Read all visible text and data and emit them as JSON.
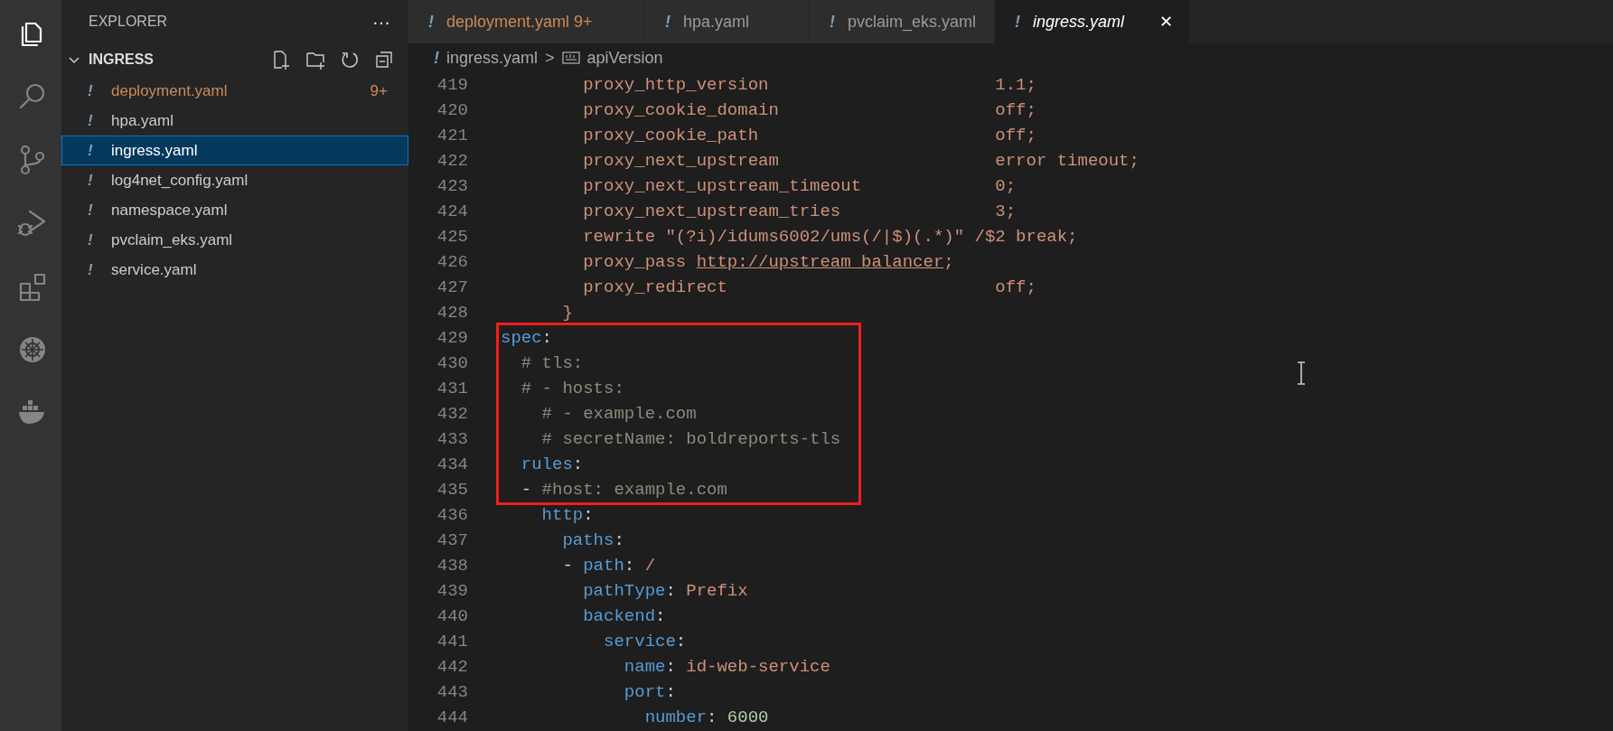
{
  "activity_bar": {
    "items": [
      {
        "kind": "files",
        "selected": true
      },
      {
        "kind": "search",
        "selected": false
      },
      {
        "kind": "source-control",
        "selected": false
      },
      {
        "kind": "debug",
        "selected": false
      },
      {
        "kind": "extensions",
        "selected": false
      },
      {
        "kind": "kubernetes",
        "selected": false
      },
      {
        "kind": "docker",
        "selected": false
      }
    ]
  },
  "sidebar": {
    "title": "EXPLORER",
    "more": "···",
    "section": {
      "title": "INGRESS",
      "expanded": true,
      "files": [
        {
          "icon": "!",
          "name": "deployment.yaml",
          "badge": "9+",
          "warning": true,
          "selected": false
        },
        {
          "icon": "!",
          "name": "hpa.yaml",
          "warning": false,
          "selected": false
        },
        {
          "icon": "!",
          "name": "ingress.yaml",
          "warning": false,
          "selected": true
        },
        {
          "icon": "!",
          "name": "log4net_config.yaml",
          "warning": false,
          "selected": false
        },
        {
          "icon": "!",
          "name": "namespace.yaml",
          "warning": false,
          "selected": false
        },
        {
          "icon": "!",
          "name": "pvclaim_eks.yaml",
          "warning": false,
          "selected": false
        },
        {
          "icon": "!",
          "name": "service.yaml",
          "warning": false,
          "selected": false
        }
      ]
    }
  },
  "tabs": [
    {
      "icon": "!",
      "label": "deployment.yaml",
      "badge": "9+",
      "warning": true,
      "selected": false
    },
    {
      "icon": "!",
      "label": "hpa.yaml",
      "warning": false,
      "selected": false
    },
    {
      "icon": "!",
      "label": "pvclaim_eks.yaml",
      "warning": false,
      "selected": false
    },
    {
      "icon": "!",
      "label": "ingress.yaml",
      "warning": false,
      "selected": true,
      "close": "✕"
    }
  ],
  "breadcrumb": {
    "icon": "!",
    "file": "ingress.yaml",
    "separator": ">",
    "symbol": "apiVersion"
  },
  "code_blocks": [
    {
      "boxed": false,
      "lines": [
        {
          "number": "419",
          "tokens": [
            {
              "text": "        proxy_http_version                      1.1;",
              "kind": "string"
            }
          ]
        },
        {
          "number": "420",
          "tokens": [
            {
              "text": "        proxy_cookie_domain                     off;",
              "kind": "string"
            }
          ]
        },
        {
          "number": "421",
          "tokens": [
            {
              "text": "        proxy_cookie_path                       off;",
              "kind": "string"
            }
          ]
        },
        {
          "number": "422",
          "tokens": [
            {
              "text": "        proxy_next_upstream                     error timeout;",
              "kind": "string"
            }
          ]
        },
        {
          "number": "423",
          "tokens": [
            {
              "text": "        proxy_next_upstream_timeout             0;",
              "kind": "string"
            }
          ]
        },
        {
          "number": "424",
          "tokens": [
            {
              "text": "        proxy_next_upstream_tries               3;",
              "kind": "string"
            }
          ]
        },
        {
          "number": "425",
          "tokens": [
            {
              "text": "        rewrite \"(?i)/idums6002/ums(/|$)(.*)\" /$2 break;",
              "kind": "string"
            }
          ]
        },
        {
          "number": "426",
          "tokens": [
            {
              "text": "        proxy_pass ",
              "kind": "string"
            },
            {
              "text": "http://upstream_balancer",
              "kind": "link"
            },
            {
              "text": ";",
              "kind": "string"
            }
          ]
        },
        {
          "number": "427",
          "tokens": [
            {
              "text": "        proxy_redirect                          off;",
              "kind": "string"
            }
          ]
        },
        {
          "number": "428",
          "tokens": [
            {
              "text": "      }",
              "kind": "string"
            }
          ]
        }
      ]
    },
    {
      "boxed": true,
      "lines": [
        {
          "number": "429",
          "tokens": [
            {
              "text": "spec",
              "kind": "key"
            },
            {
              "text": ":",
              "kind": "punct"
            }
          ]
        },
        {
          "number": "430",
          "tokens": [
            {
              "text": "  # tls:",
              "kind": "comment"
            }
          ]
        },
        {
          "number": "431",
          "tokens": [
            {
              "text": "  # - hosts:",
              "kind": "comment"
            }
          ]
        },
        {
          "number": "432",
          "tokens": [
            {
              "text": "    # - example.com",
              "kind": "comment"
            }
          ]
        },
        {
          "number": "433",
          "tokens": [
            {
              "text": "    # secretName: boldreports-tls",
              "kind": "comment"
            }
          ]
        },
        {
          "number": "434",
          "tokens": [
            {
              "text": "  rules",
              "kind": "key"
            },
            {
              "text": ":",
              "kind": "punct"
            }
          ]
        },
        {
          "number": "435",
          "tokens": [
            {
              "text": "  - ",
              "kind": "punct"
            },
            {
              "text": "#host: example.com",
              "kind": "comment"
            }
          ]
        }
      ]
    },
    {
      "boxed": false,
      "lines": [
        {
          "number": "436",
          "tokens": [
            {
              "text": "    http",
              "kind": "key"
            },
            {
              "text": ":",
              "kind": "punct"
            }
          ]
        },
        {
          "number": "437",
          "tokens": [
            {
              "text": "      paths",
              "kind": "key"
            },
            {
              "text": ":",
              "kind": "punct"
            }
          ]
        },
        {
          "number": "438",
          "tokens": [
            {
              "text": "      - ",
              "kind": "punct"
            },
            {
              "text": "path",
              "kind": "key"
            },
            {
              "text": ": ",
              "kind": "punct"
            },
            {
              "text": "/",
              "kind": "string"
            }
          ]
        },
        {
          "number": "439",
          "tokens": [
            {
              "text": "        pathType",
              "kind": "key"
            },
            {
              "text": ": ",
              "kind": "punct"
            },
            {
              "text": "Prefix",
              "kind": "string"
            }
          ]
        },
        {
          "number": "440",
          "tokens": [
            {
              "text": "        backend",
              "kind": "key"
            },
            {
              "text": ":",
              "kind": "punct"
            }
          ]
        },
        {
          "number": "441",
          "tokens": [
            {
              "text": "          service",
              "kind": "key"
            },
            {
              "text": ":",
              "kind": "punct"
            }
          ]
        },
        {
          "number": "442",
          "tokens": [
            {
              "text": "            name",
              "kind": "key"
            },
            {
              "text": ": ",
              "kind": "punct"
            },
            {
              "text": "id-web-service",
              "kind": "string"
            }
          ]
        },
        {
          "number": "443",
          "tokens": [
            {
              "text": "            port",
              "kind": "key"
            },
            {
              "text": ":",
              "kind": "punct"
            }
          ]
        },
        {
          "number": "444",
          "tokens": [
            {
              "text": "              number",
              "kind": "key"
            },
            {
              "text": ": ",
              "kind": "punct"
            },
            {
              "text": "6000",
              "kind": "number"
            }
          ]
        }
      ]
    }
  ]
}
